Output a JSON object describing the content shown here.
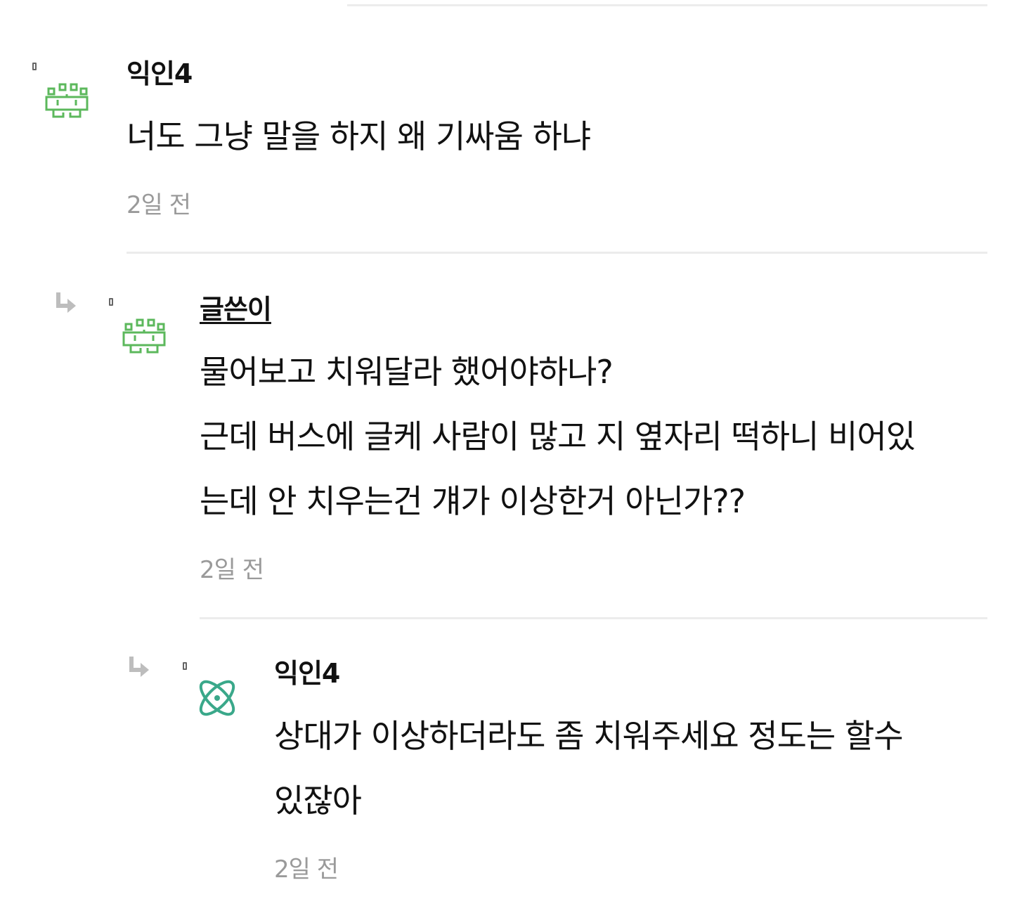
{
  "comments": [
    {
      "author": "익인4",
      "is_op": false,
      "avatar_icon": "pixel-invader-icon",
      "avatar_color": "#5cb85c",
      "lines": [
        "너도 그냥 말을 하지 왜 기싸움 하냐"
      ],
      "time": "2일 전"
    },
    {
      "author": "글쓴이",
      "is_op": true,
      "avatar_icon": "pixel-invader-icon",
      "avatar_color": "#5cb85c",
      "lines": [
        "물어보고 치워달라 했어야하나?",
        "근데 버스에 글케 사람이 많고 지 옆자리 떡하니 비어있",
        "는데 안 치우는건 걔가 이상한거 아닌가??"
      ],
      "time": "2일 전"
    },
    {
      "author": "익인4",
      "is_op": false,
      "avatar_icon": "atom-icon",
      "avatar_color": "#3aa88a",
      "lines": [
        "상대가 이상하더라도 좀 치워주세요 정도는 할수",
        "있잖아"
      ],
      "time": "2일 전"
    }
  ],
  "reply_icon": "reply-arrow-icon",
  "reply_icon_color": "#bdbdbd",
  "divider_color": "#ececec"
}
